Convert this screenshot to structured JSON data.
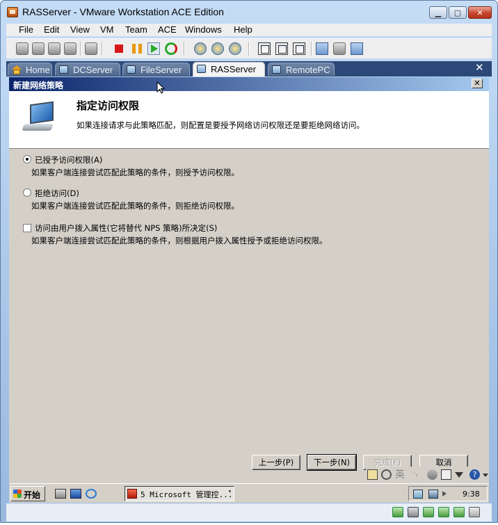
{
  "window": {
    "title": "RASServer - VMware Workstation ACE Edition",
    "controls": {
      "minimize": "▁",
      "maximize": "▢",
      "close": "✕"
    }
  },
  "menubar": {
    "items": [
      "File",
      "Edit",
      "View",
      "VM",
      "Team",
      "ACE",
      "Windows",
      "Help"
    ]
  },
  "toolbar": {
    "icons": [
      "power-off-icon",
      "suspend-icon",
      "power-on-icon",
      "reset-icon",
      "snapshot-icon",
      "stop-icon",
      "pause-icon",
      "play-icon",
      "restart-icon",
      "take-snapshot-icon",
      "revert-snapshot-icon",
      "snapshot-manager-icon",
      "sidebar-view-icon",
      "fullscreen-icon",
      "quick-switch-icon",
      "summary-view-icon",
      "console-view-icon",
      "appliance-view-icon"
    ]
  },
  "tabs": {
    "items": [
      {
        "label": "Home",
        "icon": "home-icon",
        "active": false
      },
      {
        "label": "DCServer",
        "icon": "vm-icon",
        "active": false
      },
      {
        "label": "FileServer",
        "icon": "vm-icon",
        "active": false
      },
      {
        "label": "RASServer",
        "icon": "vm-icon",
        "active": true
      },
      {
        "label": "RemotePC",
        "icon": "vm-icon",
        "active": false
      }
    ],
    "close": "✕"
  },
  "wizard": {
    "title": "新建网络策略",
    "close": "✕",
    "heading": "指定访问权限",
    "subtext": "如果连接请求与此策略匹配，则配置是要授予网络访问权限还是要拒绝网络访问。",
    "options": [
      {
        "type": "radio",
        "checked": true,
        "label": "已授予访问权限(A)",
        "desc": "如果客户端连接尝试匹配此策略的条件，则授予访问权限。"
      },
      {
        "type": "radio",
        "checked": false,
        "label": "拒绝访问(D)",
        "desc": "如果客户端连接尝试匹配此策略的条件，则拒绝访问权限。"
      },
      {
        "type": "checkbox",
        "checked": false,
        "label": "访问由用户拨入属性(它将替代 NPS 策略)所决定(S)",
        "desc": "如果客户端连接尝试匹配此策略的条件，则根据用户拨入属性授予或拒绝访问权限。"
      }
    ],
    "buttons": {
      "back": "上一步(P)",
      "next": "下一步(N)",
      "finish": "完成(F)",
      "cancel": "取消"
    }
  },
  "guest_taskbar": {
    "start_label": "开始",
    "task_label": "5 Microsoft 管理控...",
    "task_caret": "▾",
    "clock": "9:38",
    "lang_text": "英"
  }
}
